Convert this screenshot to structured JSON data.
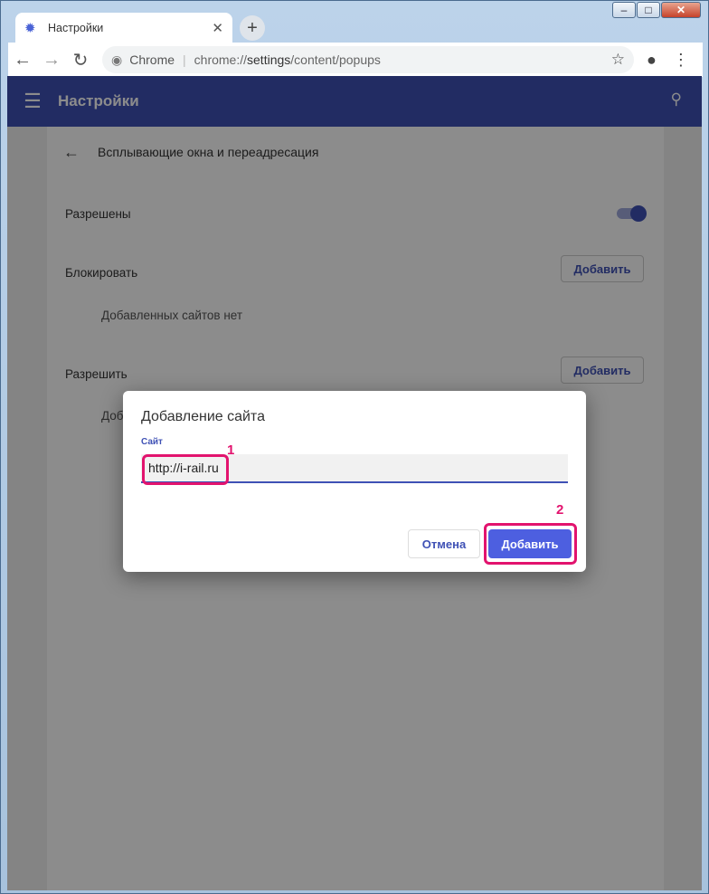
{
  "tab": {
    "title": "Настройки",
    "icon": "gear-icon"
  },
  "toolbar": {
    "site_label": "Chrome",
    "url_scheme": "chrome://",
    "url_host": "settings",
    "url_path": "/content/popups"
  },
  "appbar": {
    "title": "Настройки"
  },
  "section": {
    "title": "Всплывающие окна и переадресация",
    "allowed_label": "Разрешены",
    "allowed_on": true,
    "block_label": "Блокировать",
    "block_add": "Добавить",
    "block_empty": "Добавленных сайтов нет",
    "allow_label": "Разрешить",
    "allow_add": "Добавить",
    "allow_empty_partial": "Доб"
  },
  "dialog": {
    "title": "Добавление сайта",
    "field_label": "Сайт",
    "site_value": "http://i-rail.ru",
    "cancel_label": "Отмена",
    "add_label": "Добавить"
  },
  "annotations": {
    "step1": "1",
    "step2": "2",
    "color": "#e2136e"
  },
  "colors": {
    "accent": "#3f51b5",
    "button": "#4d5fe0"
  }
}
